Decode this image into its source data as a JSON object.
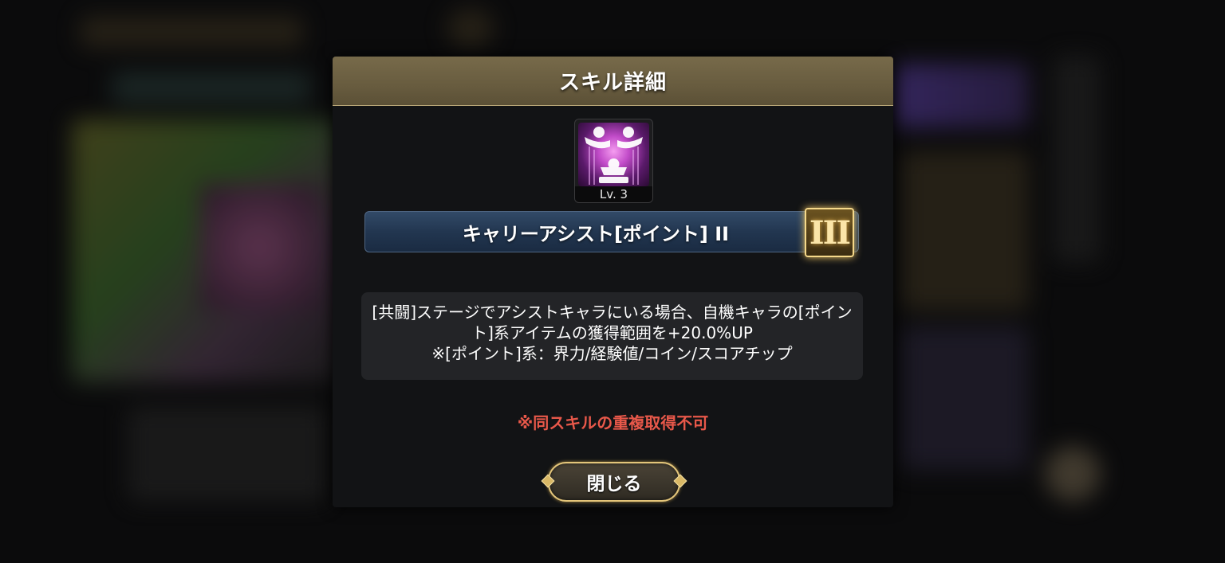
{
  "dialog": {
    "title": "スキル詳細",
    "skill": {
      "icon": "carry-assist-icon",
      "level": "Lv. 3",
      "name": "キャリーアシスト[ポイント] II",
      "rank": "III"
    },
    "description": {
      "line1": "[共闘]ステージでアシストキャラにいる場合、自機キャラの[ポイント]系アイテムの獲得範囲を+20.0%UP",
      "line2": "※[ポイント]系：界力/経験値/コイン/スコアチップ"
    },
    "note": "※同スキルの重複取得不可",
    "close_label": "閉じる"
  },
  "colors": {
    "header": "#776a4a",
    "name_bar": "#223650",
    "note": "#e8584a",
    "button_border": "#e3c57a"
  }
}
